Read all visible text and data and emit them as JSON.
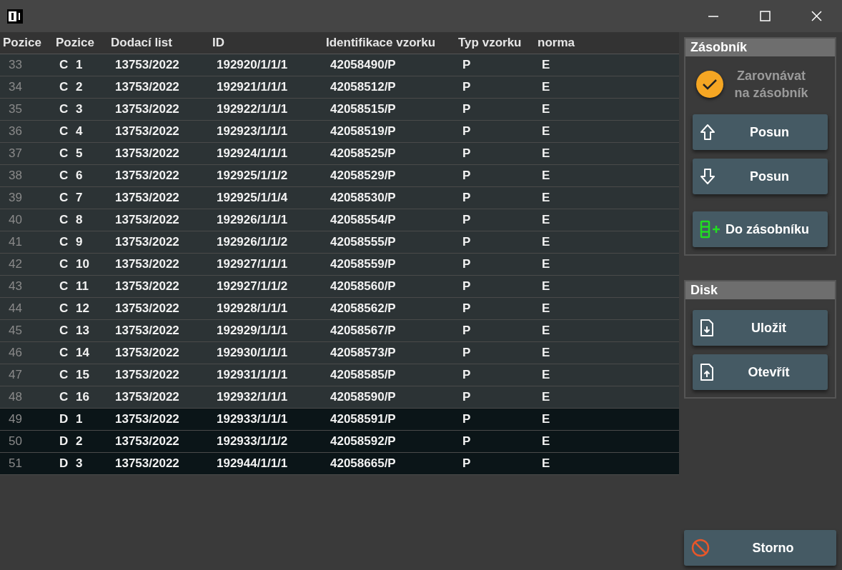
{
  "table": {
    "columns": [
      "Pozice",
      "Pozice",
      "Dodací list",
      "ID",
      "Identifikace vzorku",
      "Typ vzorku",
      "norma"
    ],
    "rows": [
      {
        "cells": [
          "33",
          "C 1",
          "13753/2022",
          "192920/1/1/1",
          "42058490/P",
          "P",
          "E"
        ],
        "selected": false
      },
      {
        "cells": [
          "34",
          "C 2",
          "13753/2022",
          "192921/1/1/1",
          "42058512/P",
          "P",
          "E"
        ],
        "selected": false
      },
      {
        "cells": [
          "35",
          "C 3",
          "13753/2022",
          "192922/1/1/1",
          "42058515/P",
          "P",
          "E"
        ],
        "selected": false
      },
      {
        "cells": [
          "36",
          "C 4",
          "13753/2022",
          "192923/1/1/1",
          "42058519/P",
          "P",
          "E"
        ],
        "selected": false
      },
      {
        "cells": [
          "37",
          "C 5",
          "13753/2022",
          "192924/1/1/1",
          "42058525/P",
          "P",
          "E"
        ],
        "selected": false
      },
      {
        "cells": [
          "38",
          "C 6",
          "13753/2022",
          "192925/1/1/2",
          "42058529/P",
          "P",
          "E"
        ],
        "selected": false
      },
      {
        "cells": [
          "39",
          "C 7",
          "13753/2022",
          "192925/1/1/4",
          "42058530/P",
          "P",
          "E"
        ],
        "selected": false
      },
      {
        "cells": [
          "40",
          "C 8",
          "13753/2022",
          "192926/1/1/1",
          "42058554/P",
          "P",
          "E"
        ],
        "selected": false
      },
      {
        "cells": [
          "41",
          "C 9",
          "13753/2022",
          "192926/1/1/2",
          "42058555/P",
          "P",
          "E"
        ],
        "selected": false
      },
      {
        "cells": [
          "42",
          "C 10",
          "13753/2022",
          "192927/1/1/1",
          "42058559/P",
          "P",
          "E"
        ],
        "selected": false
      },
      {
        "cells": [
          "43",
          "C 11",
          "13753/2022",
          "192927/1/1/2",
          "42058560/P",
          "P",
          "E"
        ],
        "selected": false
      },
      {
        "cells": [
          "44",
          "C 12",
          "13753/2022",
          "192928/1/1/1",
          "42058562/P",
          "P",
          "E"
        ],
        "selected": false
      },
      {
        "cells": [
          "45",
          "C 13",
          "13753/2022",
          "192929/1/1/1",
          "42058567/P",
          "P",
          "E"
        ],
        "selected": false
      },
      {
        "cells": [
          "46",
          "C 14",
          "13753/2022",
          "192930/1/1/1",
          "42058573/P",
          "P",
          "E"
        ],
        "selected": false
      },
      {
        "cells": [
          "47",
          "C 15",
          "13753/2022",
          "192931/1/1/1",
          "42058585/P",
          "P",
          "E"
        ],
        "selected": false
      },
      {
        "cells": [
          "48",
          "C 16",
          "13753/2022",
          "192932/1/1/1",
          "42058590/P",
          "P",
          "E"
        ],
        "selected": false
      },
      {
        "cells": [
          "49",
          "D 1",
          "13753/2022",
          "192933/1/1/1",
          "42058591/P",
          "P",
          "E"
        ],
        "selected": true
      },
      {
        "cells": [
          "50",
          "D 2",
          "13753/2022",
          "192933/1/1/2",
          "42058592/P",
          "P",
          "E"
        ],
        "selected": true
      },
      {
        "cells": [
          "51",
          "D 3",
          "13753/2022",
          "192944/1/1/1",
          "42058665/P",
          "P",
          "E"
        ],
        "selected": true
      }
    ]
  },
  "panels": [
    {
      "title": "Zásobník",
      "items": [
        {
          "kind": "checkbox",
          "label": "Zarovnávat na zásobník",
          "checked": true
        },
        {
          "kind": "up",
          "label": "Posun"
        },
        {
          "kind": "down",
          "label": "Posun"
        },
        {
          "kind": "add",
          "label": "Do zásobníku"
        }
      ]
    },
    {
      "title": "Disk",
      "items": [
        {
          "kind": "save",
          "label": "Uložit"
        },
        {
          "kind": "open",
          "label": "Otevřít"
        }
      ]
    }
  ],
  "cancel_button": {
    "label": "Storno"
  }
}
